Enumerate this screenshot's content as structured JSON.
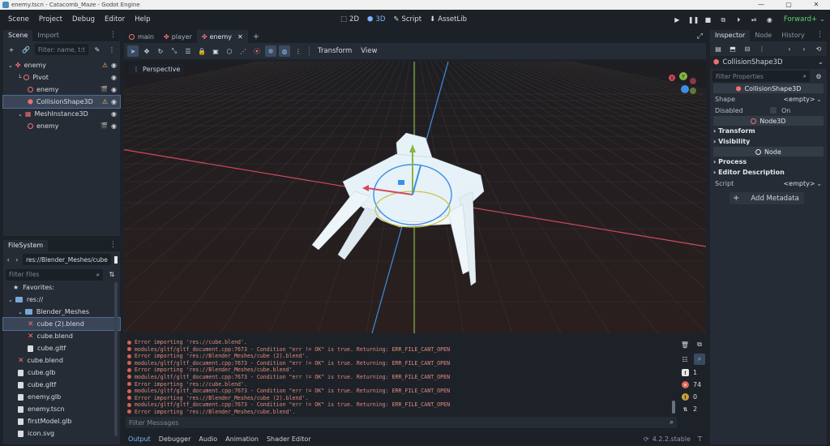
{
  "window": {
    "title": "enemy.tscn - Catacomb_Maze - Godot Engine"
  },
  "menu": [
    "Scene",
    "Project",
    "Debug",
    "Editor",
    "Help"
  ],
  "main_tabs": [
    {
      "label": "2D",
      "active": false
    },
    {
      "label": "3D",
      "active": true
    },
    {
      "label": "Script",
      "active": false
    },
    {
      "label": "AssetLib",
      "active": false
    }
  ],
  "renderer": "Forward+",
  "scene_dock": {
    "tabs": [
      "Scene",
      "Import"
    ],
    "filter_placeholder": "Filter: name, t:t",
    "nodes": [
      {
        "label": "enemy",
        "depth": 0,
        "icon": "character-body-icon",
        "warn": true,
        "vis": true
      },
      {
        "label": "Pivot",
        "depth": 1,
        "icon": "node3d-icon",
        "warn": false,
        "vis": true
      },
      {
        "label": "enemy",
        "depth": 2,
        "icon": "node3d-icon",
        "warn": false,
        "vis": true
      },
      {
        "label": "CollisionShape3D",
        "depth": 2,
        "icon": "collision-shape-icon",
        "warn": true,
        "vis": true
      },
      {
        "label": "MeshInstance3D",
        "depth": 1,
        "icon": "mesh-instance-icon",
        "warn": false,
        "vis": true
      },
      {
        "label": "enemy",
        "depth": 2,
        "icon": "node3d-icon",
        "warn": false,
        "vis": true
      }
    ]
  },
  "filesystem": {
    "tab": "FileSystem",
    "path": "res://Blender_Meshes/cube",
    "filter_placeholder": "Filter Files",
    "favorites": "Favorites:",
    "items": [
      {
        "label": "res://",
        "depth": 0,
        "type": "folder"
      },
      {
        "label": "Blender_Meshes",
        "depth": 1,
        "type": "folder"
      },
      {
        "label": "cube (2).blend",
        "depth": 2,
        "type": "broken"
      },
      {
        "label": "cube.blend",
        "depth": 2,
        "type": "broken"
      },
      {
        "label": "cube.gltf",
        "depth": 2,
        "type": "file"
      },
      {
        "label": "cube.blend",
        "depth": 1,
        "type": "broken"
      },
      {
        "label": "cube.glb",
        "depth": 1,
        "type": "file"
      },
      {
        "label": "cube.gltf",
        "depth": 1,
        "type": "file"
      },
      {
        "label": "enemy.glb",
        "depth": 1,
        "type": "file"
      },
      {
        "label": "enemy.tscn",
        "depth": 1,
        "type": "file"
      },
      {
        "label": "firstModel.glb",
        "depth": 1,
        "type": "file"
      },
      {
        "label": "icon.svg",
        "depth": 1,
        "type": "file"
      }
    ]
  },
  "editor_tabs": [
    {
      "label": "main",
      "active": false
    },
    {
      "label": "player",
      "active": false
    },
    {
      "label": "enemy",
      "active": true
    }
  ],
  "toolbar": {
    "transform": "Transform",
    "view": "View"
  },
  "viewport": {
    "label": "Perspective",
    "gizmo": {
      "x": "X",
      "y": "Y"
    }
  },
  "output": {
    "lines": [
      "Error importing 'res://cube.blend'.",
      "modules/gltf/gltf_document.cpp:7673 - Condition \"err != OK\" is true. Returning: ERR_FILE_CANT_OPEN",
      "Error importing 'res://Blender_Meshes/cube (2).blend'.",
      "modules/gltf/gltf_document.cpp:7673 - Condition \"err != OK\" is true. Returning: ERR_FILE_CANT_OPEN",
      "Error importing 'res://Blender_Meshes/cube.blend'.",
      "modules/gltf/gltf_document.cpp:7673 - Condition \"err != OK\" is true. Returning: ERR_FILE_CANT_OPEN",
      "Error importing 'res://cube.blend'.",
      "modules/gltf/gltf_document.cpp:7673 - Condition \"err != OK\" is true. Returning: ERR_FILE_CANT_OPEN",
      "Error importing 'res://Blender_Meshes/cube (2).blend'.",
      "modules/gltf/gltf_document.cpp:7673 - Condition \"err != OK\" is true. Returning: ERR_FILE_CANT_OPEN",
      "Error importing 'res://Blender_Meshes/cube.blend'."
    ],
    "filter_placeholder": "Filter Messages",
    "counts": {
      "messages": "1",
      "errors": "74",
      "warnings": "0",
      "editor": "2"
    }
  },
  "bottom_tabs": [
    "Output",
    "Debugger",
    "Audio",
    "Animation",
    "Shader Editor"
  ],
  "version": "4.2.2.stable",
  "inspector": {
    "tabs": [
      "Inspector",
      "Node",
      "History"
    ],
    "object": "CollisionShape3D",
    "filter_placeholder": "Filter Properties",
    "section_class": "CollisionShape3D",
    "shape_label": "Shape",
    "shape_value": "<empty>",
    "disabled_label": "Disabled",
    "disabled_value": "On",
    "node3d_section": "Node3D",
    "transform": "Transform",
    "visibility": "Visibility",
    "node_section": "Node",
    "process": "Process",
    "editor_description": "Editor Description",
    "script_label": "Script",
    "script_value": "<empty>",
    "add_metadata": "Add Metadata"
  },
  "colors": {
    "accent": "#79b6ff",
    "error": "#e06050",
    "renderer": "#5fd46a",
    "warning": "#f0c040"
  }
}
